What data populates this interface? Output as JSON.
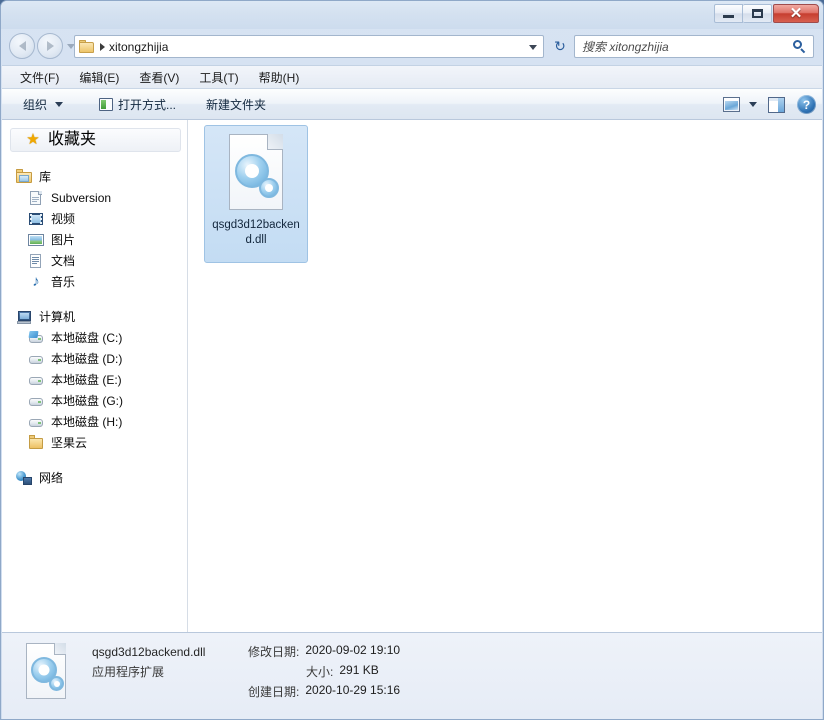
{
  "window": {
    "minimize_label": "",
    "maximize_label": "",
    "close_label": "✕"
  },
  "address_bar": {
    "crumb": "xitongzhijia",
    "refresh_glyph": "↻",
    "dropdown_glyph": "▾"
  },
  "search": {
    "placeholder": "搜索 xitongzhijia"
  },
  "menubar": {
    "items": [
      {
        "label": "文件(F)"
      },
      {
        "label": "编辑(E)"
      },
      {
        "label": "查看(V)"
      },
      {
        "label": "工具(T)"
      },
      {
        "label": "帮助(H)"
      }
    ]
  },
  "toolbar": {
    "organize_label": "组织",
    "open_with_label": "打开方式...",
    "new_folder_label": "新建文件夹",
    "help_glyph": "?"
  },
  "sidebar": {
    "favorites": {
      "label": "收藏夹"
    },
    "library": {
      "label": "库"
    },
    "library_items": [
      {
        "label": "Subversion",
        "icon": "subversion-icon"
      },
      {
        "label": "视频",
        "icon": "video-icon"
      },
      {
        "label": "图片",
        "icon": "picture-icon"
      },
      {
        "label": "文档",
        "icon": "document-icon"
      },
      {
        "label": "音乐",
        "icon": "music-icon",
        "glyph": "♪"
      }
    ],
    "computer": {
      "label": "计算机"
    },
    "computer_items": [
      {
        "label": "本地磁盘 (C:)",
        "icon": "drive-c-icon"
      },
      {
        "label": "本地磁盘 (D:)",
        "icon": "drive-icon"
      },
      {
        "label": "本地磁盘 (E:)",
        "icon": "drive-icon"
      },
      {
        "label": "本地磁盘 (G:)",
        "icon": "drive-icon"
      },
      {
        "label": "本地磁盘 (H:)",
        "icon": "drive-icon"
      },
      {
        "label": "坚果云",
        "icon": "folder-icon"
      }
    ],
    "network": {
      "label": "网络"
    }
  },
  "content": {
    "file": {
      "name": "qsgd3d12backend.dll"
    }
  },
  "details": {
    "file_name": "qsgd3d12backend.dll",
    "file_type": "应用程序扩展",
    "modified_key": "修改日期:",
    "modified_value": "2020-09-02 19:10",
    "size_key": "大小:",
    "size_value": "291 KB",
    "created_key": "创建日期:",
    "created_value": "2020-10-29 15:16"
  }
}
